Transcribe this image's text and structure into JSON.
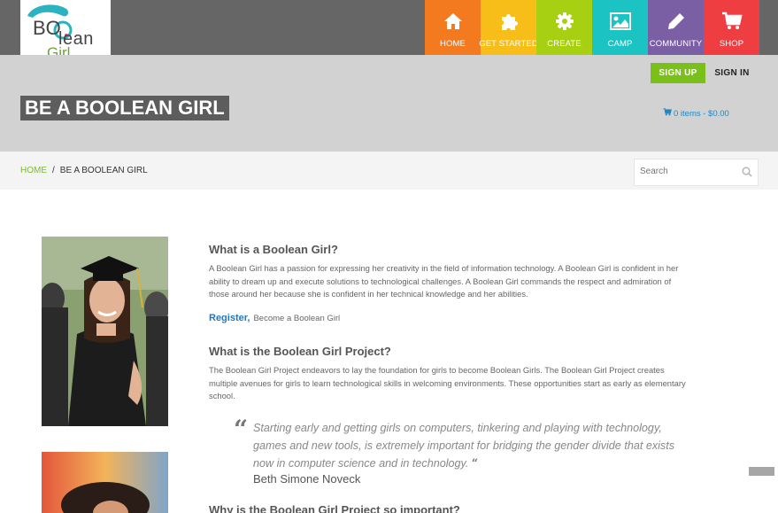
{
  "logo": {
    "text_b": "BO",
    "text_lean": "lean",
    "text_girl": "Girl"
  },
  "nav": {
    "items": [
      {
        "label": "HOME",
        "icon": "home-icon",
        "color": "#f47a1f"
      },
      {
        "label": "GET STARTED",
        "icon": "puzzle-icon",
        "color": "#f7be19"
      },
      {
        "label": "CREATE",
        "icon": "gear-icon",
        "color": "#a8d012"
      },
      {
        "label": "CAMP",
        "icon": "image-icon",
        "color": "#1cc3c3"
      },
      {
        "label": "COMMUNITY",
        "icon": "pencil-icon",
        "color": "#7a5fa5"
      },
      {
        "label": "SHOP",
        "icon": "cart-icon",
        "color": "#ef3e42"
      }
    ]
  },
  "header": {
    "signup": "SIGN UP",
    "signin": "SIGN IN",
    "title": "BE A BOOLEAN GIRL",
    "cart": "0 items - $0.00"
  },
  "breadcrumb": {
    "home": "HOME",
    "separator": "/",
    "current": "BE A BOOLEAN GIRL"
  },
  "search": {
    "placeholder": "Search"
  },
  "content": {
    "section1": {
      "heading": "What is a Boolean Girl?",
      "body": "A Boolean Girl has a passion for expressing her creativity in the field of information technology. A Boolean Girl is confident in her ability to dream up and execute solutions to technological challenges. A Boolean Girl commands the respect and admiration of those around her because she is confident in her technical knowledge and her abilities."
    },
    "register": {
      "link": "Register,",
      "desc": "Become a Boolean Girl"
    },
    "section2": {
      "heading": "What is the Boolean Girl Project?",
      "body": "The Boolean Girl Project endeavors to lay the foundation for girls to become Boolean Girls. The Boolean Girl Project creates multiple avenues for girls to learn technological skills in welcoming environments. These opportunities start as early as elementary school."
    },
    "quote": {
      "text": "Starting early and getting girls on computers, tinkering and playing with technology, games and new tools, is extremely important for bridging the gender divide that exists now in computer science and in technology.",
      "author": "Beth Simone Noveck"
    },
    "section3": {
      "heading": "Why is the Boolean Girl Project so important?"
    }
  },
  "colors": {
    "accent_green": "#7bbf1b",
    "link_blue": "#1e78c2",
    "title_bg": "#5d5d5d"
  }
}
